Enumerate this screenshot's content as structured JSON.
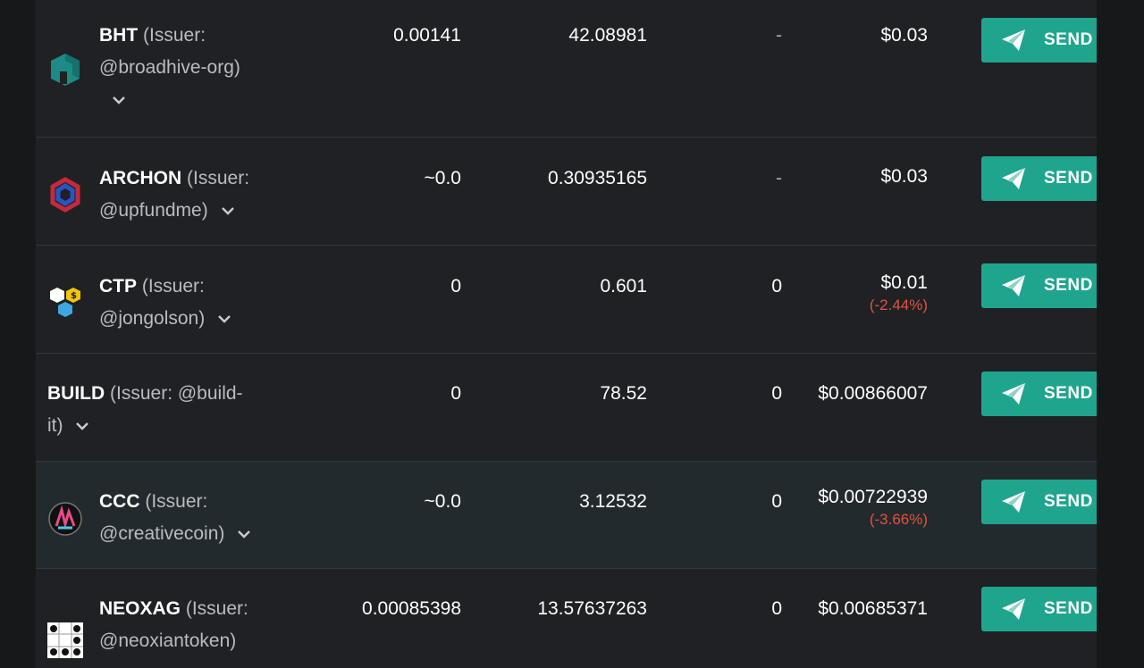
{
  "columns_note": "",
  "send_label": "SEND",
  "issuer_prefix": "(Issuer:",
  "rows": [
    {
      "symbol": "BHT",
      "issuer_a": "(Issuer:",
      "issuer_b": "@broadhive-org)",
      "c1": "0.00141",
      "c2": "42.08981",
      "c3": "-",
      "price": "$0.03",
      "change": ""
    },
    {
      "symbol": "ARCHON",
      "issuer_a": "(Issuer:",
      "issuer_b": "@upfundme)",
      "c1": "~0.0",
      "c2": "0.30935165",
      "c3": "-",
      "price": "$0.03",
      "change": ""
    },
    {
      "symbol": "CTP",
      "issuer_a": "(Issuer:",
      "issuer_b": "@jongolson)",
      "c1": "0",
      "c2": "0.601",
      "c3": "0",
      "price": "$0.01",
      "change": "(-2.44%)"
    },
    {
      "symbol": "BUILD",
      "issuer_a": "(Issuer: @build-",
      "issuer_b": "it)",
      "c1": "0",
      "c2": "78.52",
      "c3": "0",
      "price": "$0.00866007",
      "change": ""
    },
    {
      "symbol": "CCC",
      "issuer_a": "(Issuer:",
      "issuer_b": "@creativecoin)",
      "c1": "~0.0",
      "c2": "3.12532",
      "c3": "0",
      "price": "$0.00722939",
      "change": "(-3.66%)"
    },
    {
      "symbol": "NEOXAG",
      "issuer_a": "(Issuer:",
      "issuer_b": "@neoxiantoken)",
      "c1": "0.00085398",
      "c2": "13.57637263",
      "c3": "0",
      "price": "$0.00685371",
      "change": ""
    }
  ],
  "colors": {
    "accent": "#1fa58e",
    "negative": "#e2523f",
    "background": "#1f2124",
    "highlight_row": "#232a2d"
  }
}
